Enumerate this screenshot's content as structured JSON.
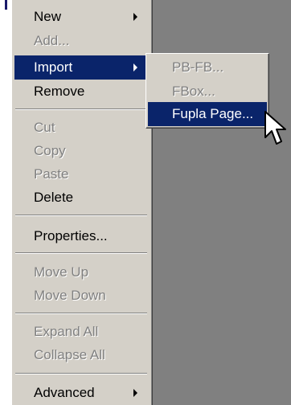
{
  "menu": {
    "items": [
      {
        "label": "New",
        "disabled": false,
        "submenu": true
      },
      {
        "label": "Add...",
        "disabled": true,
        "submenu": false
      },
      {
        "label": "Import",
        "disabled": false,
        "submenu": true,
        "selected": true
      },
      {
        "label": "Remove",
        "disabled": false,
        "submenu": false
      },
      {
        "label": "Cut",
        "disabled": true,
        "submenu": false
      },
      {
        "label": "Copy",
        "disabled": true,
        "submenu": false
      },
      {
        "label": "Paste",
        "disabled": true,
        "submenu": false
      },
      {
        "label": "Delete",
        "disabled": false,
        "submenu": false
      },
      {
        "label": "Properties...",
        "disabled": false,
        "submenu": false
      },
      {
        "label": "Move Up",
        "disabled": true,
        "submenu": false
      },
      {
        "label": "Move Down",
        "disabled": true,
        "submenu": false
      },
      {
        "label": "Expand All",
        "disabled": true,
        "submenu": false
      },
      {
        "label": "Collapse All",
        "disabled": true,
        "submenu": false
      },
      {
        "label": "Advanced",
        "disabled": false,
        "submenu": true
      }
    ]
  },
  "submenu": {
    "items": [
      {
        "label": "PB-FB...",
        "disabled": true
      },
      {
        "label": "FBox...",
        "disabled": true
      },
      {
        "label": "Fupla Page...",
        "disabled": false,
        "selected": true
      }
    ]
  },
  "colors": {
    "highlight": "#0a246a",
    "menu_face": "#d4d0c8",
    "background": "#808080",
    "disabled_text": "#808080"
  },
  "cursor": {
    "icon": "arrow-pointer-icon"
  }
}
